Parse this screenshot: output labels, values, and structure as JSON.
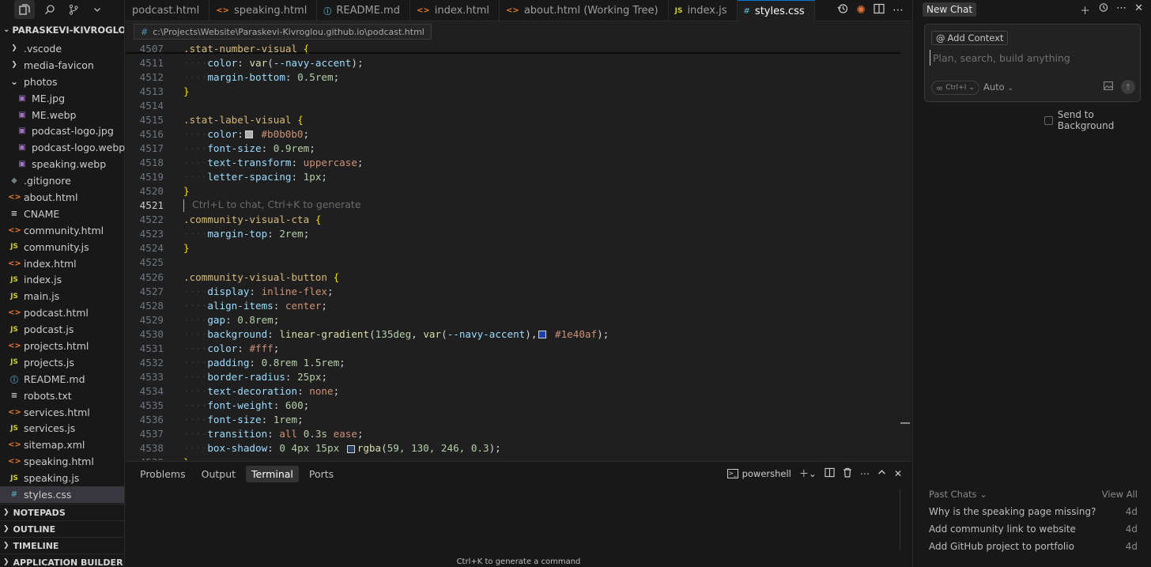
{
  "explorer": {
    "root_title": "PARASKEVI-KIVROGLOU.G...",
    "items": [
      {
        "label": ".vscode",
        "icon": "chevron-right",
        "indent": 1
      },
      {
        "label": "media-favicon",
        "icon": "chevron-right",
        "indent": 1
      },
      {
        "label": "photos",
        "icon": "chevron-down",
        "indent": 1
      },
      {
        "label": "ME.jpg",
        "icon": "image",
        "indent": 2
      },
      {
        "label": "ME.webp",
        "icon": "image",
        "indent": 2
      },
      {
        "label": "podcast-logo.jpg",
        "icon": "image",
        "indent": 2
      },
      {
        "label": "podcast-logo.webp",
        "icon": "image",
        "indent": 2
      },
      {
        "label": "speaking.webp",
        "icon": "image",
        "indent": 2
      },
      {
        "label": ".gitignore",
        "icon": "git",
        "indent": 1
      },
      {
        "label": "about.html",
        "icon": "html",
        "indent": 1
      },
      {
        "label": "CNAME",
        "icon": "lines",
        "indent": 1
      },
      {
        "label": "community.html",
        "icon": "html",
        "indent": 1
      },
      {
        "label": "community.js",
        "icon": "js",
        "indent": 1
      },
      {
        "label": "index.html",
        "icon": "html",
        "indent": 1
      },
      {
        "label": "index.js",
        "icon": "js",
        "indent": 1
      },
      {
        "label": "main.js",
        "icon": "js",
        "indent": 1
      },
      {
        "label": "podcast.html",
        "icon": "html",
        "indent": 1
      },
      {
        "label": "podcast.js",
        "icon": "js",
        "indent": 1
      },
      {
        "label": "projects.html",
        "icon": "html",
        "indent": 1
      },
      {
        "label": "projects.js",
        "icon": "js",
        "indent": 1
      },
      {
        "label": "README.md",
        "icon": "info",
        "indent": 1
      },
      {
        "label": "robots.txt",
        "icon": "lines",
        "indent": 1
      },
      {
        "label": "services.html",
        "icon": "html",
        "indent": 1
      },
      {
        "label": "services.js",
        "icon": "js",
        "indent": 1
      },
      {
        "label": "sitemap.xml",
        "icon": "html",
        "indent": 1
      },
      {
        "label": "speaking.html",
        "icon": "html",
        "indent": 1
      },
      {
        "label": "speaking.js",
        "icon": "js",
        "indent": 1
      },
      {
        "label": "styles.css",
        "icon": "css",
        "indent": 1,
        "selected": true
      }
    ],
    "sections": [
      "NOTEPADS",
      "OUTLINE",
      "TIMELINE",
      "APPLICATION BUILDER"
    ]
  },
  "tabs": [
    {
      "label": "podcast.html",
      "icon": "none"
    },
    {
      "label": "speaking.html",
      "icon": "html"
    },
    {
      "label": "README.md",
      "icon": "info"
    },
    {
      "label": "index.html",
      "icon": "html"
    },
    {
      "label": "about.html (Working Tree)",
      "icon": "html"
    },
    {
      "label": "index.js",
      "icon": "js"
    },
    {
      "label": "styles.css",
      "icon": "css",
      "active": true
    }
  ],
  "breadcrumb": "c:\\Projects\\Website\\Paraskevi-Kivroglou.github.io\\podcast.html",
  "code": {
    "current_line": 4521,
    "ghost_hint": "Ctrl+L to chat, Ctrl+K to generate",
    "lines": [
      {
        "n": 4507,
        "t": [
          [
            "sel",
            ".stat-number-visual "
          ],
          [
            "brace",
            "{"
          ]
        ]
      },
      {
        "n": 4511,
        "t": [
          [
            "dots",
            "····"
          ],
          [
            "prop",
            "color"
          ],
          [
            "punc",
            ": "
          ],
          [
            "fn",
            "var"
          ],
          [
            "punc",
            "("
          ],
          [
            "prop",
            "--navy-accent"
          ],
          [
            "punc",
            ");"
          ]
        ]
      },
      {
        "n": 4512,
        "t": [
          [
            "dots",
            "····"
          ],
          [
            "prop",
            "margin-bottom"
          ],
          [
            "punc",
            ": "
          ],
          [
            "num",
            "0.5rem"
          ],
          [
            "punc",
            ";"
          ]
        ]
      },
      {
        "n": 4513,
        "t": [
          [
            "brace",
            "}"
          ]
        ]
      },
      {
        "n": 4514,
        "t": []
      },
      {
        "n": 4515,
        "t": [
          [
            "sel",
            ".stat-label-visual "
          ],
          [
            "brace",
            "{"
          ]
        ]
      },
      {
        "n": 4516,
        "t": [
          [
            "dots",
            "····"
          ],
          [
            "prop",
            "color"
          ],
          [
            "punc",
            ":"
          ],
          [
            "swatch",
            "#b0b0b0"
          ],
          [
            "val",
            " #b0b0b0"
          ],
          [
            "punc",
            ";"
          ]
        ]
      },
      {
        "n": 4517,
        "t": [
          [
            "dots",
            "····"
          ],
          [
            "prop",
            "font-size"
          ],
          [
            "punc",
            ": "
          ],
          [
            "num",
            "0.9rem"
          ],
          [
            "punc",
            ";"
          ]
        ]
      },
      {
        "n": 4518,
        "t": [
          [
            "dots",
            "····"
          ],
          [
            "prop",
            "text-transform"
          ],
          [
            "punc",
            ": "
          ],
          [
            "val",
            "uppercase"
          ],
          [
            "punc",
            ";"
          ]
        ]
      },
      {
        "n": 4519,
        "t": [
          [
            "dots",
            "····"
          ],
          [
            "prop",
            "letter-spacing"
          ],
          [
            "punc",
            ": "
          ],
          [
            "num",
            "1px"
          ],
          [
            "punc",
            ";"
          ]
        ]
      },
      {
        "n": 4520,
        "t": [
          [
            "brace",
            "}"
          ]
        ]
      },
      {
        "n": 4521,
        "t": [
          [
            "cursor",
            ""
          ],
          [
            "ghost",
            "Ctrl+L to chat, Ctrl+K to generate"
          ]
        ]
      },
      {
        "n": 4522,
        "t": [
          [
            "sel",
            ".community-visual-cta "
          ],
          [
            "brace",
            "{"
          ]
        ]
      },
      {
        "n": 4523,
        "t": [
          [
            "dots",
            "····"
          ],
          [
            "prop",
            "margin-top"
          ],
          [
            "punc",
            ": "
          ],
          [
            "num",
            "2rem"
          ],
          [
            "punc",
            ";"
          ]
        ]
      },
      {
        "n": 4524,
        "t": [
          [
            "brace",
            "}"
          ]
        ]
      },
      {
        "n": 4525,
        "t": []
      },
      {
        "n": 4526,
        "t": [
          [
            "sel",
            ".community-visual-button "
          ],
          [
            "brace",
            "{"
          ]
        ]
      },
      {
        "n": 4527,
        "t": [
          [
            "dots",
            "····"
          ],
          [
            "prop",
            "display"
          ],
          [
            "punc",
            ": "
          ],
          [
            "val",
            "inline-flex"
          ],
          [
            "punc",
            ";"
          ]
        ]
      },
      {
        "n": 4528,
        "t": [
          [
            "dots",
            "····"
          ],
          [
            "prop",
            "align-items"
          ],
          [
            "punc",
            ": "
          ],
          [
            "val",
            "center"
          ],
          [
            "punc",
            ";"
          ]
        ]
      },
      {
        "n": 4529,
        "t": [
          [
            "dots",
            "····"
          ],
          [
            "prop",
            "gap"
          ],
          [
            "punc",
            ": "
          ],
          [
            "num",
            "0.8rem"
          ],
          [
            "punc",
            ";"
          ]
        ]
      },
      {
        "n": 4530,
        "t": [
          [
            "dots",
            "····"
          ],
          [
            "prop",
            "background"
          ],
          [
            "punc",
            ": "
          ],
          [
            "fn",
            "linear-gradient"
          ],
          [
            "punc",
            "("
          ],
          [
            "num",
            "135deg"
          ],
          [
            "punc",
            ", "
          ],
          [
            "fn",
            "var"
          ],
          [
            "punc",
            "("
          ],
          [
            "prop",
            "--navy-accent"
          ],
          [
            "punc",
            "),"
          ],
          [
            "swatch",
            "#1e40af"
          ],
          [
            "val",
            " #1e40af"
          ],
          [
            "punc",
            ");"
          ]
        ]
      },
      {
        "n": 4531,
        "t": [
          [
            "dots",
            "····"
          ],
          [
            "prop",
            "color"
          ],
          [
            "punc",
            ": "
          ],
          [
            "val",
            "#fff"
          ],
          [
            "punc",
            ";"
          ]
        ]
      },
      {
        "n": 4532,
        "t": [
          [
            "dots",
            "····"
          ],
          [
            "prop",
            "padding"
          ],
          [
            "punc",
            ": "
          ],
          [
            "num",
            "0.8rem 1.5rem"
          ],
          [
            "punc",
            ";"
          ]
        ]
      },
      {
        "n": 4533,
        "t": [
          [
            "dots",
            "····"
          ],
          [
            "prop",
            "border-radius"
          ],
          [
            "punc",
            ": "
          ],
          [
            "num",
            "25px"
          ],
          [
            "punc",
            ";"
          ]
        ]
      },
      {
        "n": 4534,
        "t": [
          [
            "dots",
            "····"
          ],
          [
            "prop",
            "text-decoration"
          ],
          [
            "punc",
            ": "
          ],
          [
            "val",
            "none"
          ],
          [
            "punc",
            ";"
          ]
        ]
      },
      {
        "n": 4535,
        "t": [
          [
            "dots",
            "····"
          ],
          [
            "prop",
            "font-weight"
          ],
          [
            "punc",
            ": "
          ],
          [
            "num",
            "600"
          ],
          [
            "punc",
            ";"
          ]
        ]
      },
      {
        "n": 4536,
        "t": [
          [
            "dots",
            "····"
          ],
          [
            "prop",
            "font-size"
          ],
          [
            "punc",
            ": "
          ],
          [
            "num",
            "1rem"
          ],
          [
            "punc",
            ";"
          ]
        ]
      },
      {
        "n": 4537,
        "t": [
          [
            "dots",
            "····"
          ],
          [
            "prop",
            "transition"
          ],
          [
            "punc",
            ": "
          ],
          [
            "val",
            "all "
          ],
          [
            "num",
            "0.3s"
          ],
          [
            "val",
            " ease"
          ],
          [
            "punc",
            ";"
          ]
        ]
      },
      {
        "n": 4538,
        "t": [
          [
            "dots",
            "····"
          ],
          [
            "prop",
            "box-shadow"
          ],
          [
            "punc",
            ": "
          ],
          [
            "num",
            "0 4px 15px "
          ],
          [
            "swatch",
            "rgba(59,130,246,0.3)"
          ],
          [
            "fn",
            "rgba"
          ],
          [
            "punc",
            "("
          ],
          [
            "num",
            "59, 130, 246, 0.3"
          ],
          [
            "punc",
            ");"
          ]
        ]
      },
      {
        "n": 4539,
        "t": [
          [
            "brace",
            "}"
          ]
        ]
      }
    ]
  },
  "panel": {
    "tabs": [
      "Problems",
      "Output",
      "Terminal",
      "Ports"
    ],
    "active_tab": "Terminal",
    "shell_label": "powershell",
    "hint": "Ctrl+K to generate a command"
  },
  "chat": {
    "new_chat_label": "New Chat",
    "add_context_label": "Add Context",
    "input_placeholder": "Plan, search, build anything",
    "mode_shortcut": "Ctrl+I",
    "model_label": "Auto",
    "send_to_background_label": "Send to Background",
    "past_chats_label": "Past Chats",
    "view_all_label": "View All",
    "past_chats": [
      {
        "title": "Why is the speaking page missing?",
        "age": "4d"
      },
      {
        "title": "Add community link to website",
        "age": "4d"
      },
      {
        "title": "Add GitHub project to portfolio",
        "age": "4d"
      }
    ]
  }
}
